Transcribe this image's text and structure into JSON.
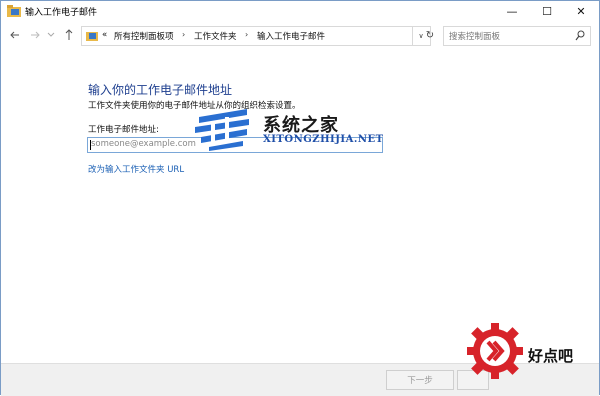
{
  "window": {
    "title": "输入工作电子邮件"
  },
  "title_controls": {
    "minimize": "—",
    "maximize": "☐",
    "close": "✕"
  },
  "address_bar": {
    "prefix": "«",
    "crumbs": [
      "所有控制面板项",
      "工作文件夹",
      "输入工作电子邮件"
    ],
    "separator": "›",
    "dropdown": "∨",
    "refresh": "↻"
  },
  "search": {
    "placeholder": "搜索控制面板"
  },
  "content": {
    "heading": "输入你的工作电子邮件地址",
    "description": "工作文件夹使用你的电子邮件地址从你的组织检索设置。",
    "field_label": "工作电子邮件地址:",
    "field_placeholder": "someone@example.com",
    "url_link": "改为输入工作文件夹 URL"
  },
  "watermark": {
    "text": "系统之家",
    "sub": "XITONGZHIJIA.NET"
  },
  "footer": {
    "next_label": "下一步"
  },
  "corner_logo": {
    "text": "好点吧"
  },
  "colors": {
    "heading": "#1e3f8f",
    "link": "#1a5fb4",
    "border": "#7a9cc6"
  }
}
